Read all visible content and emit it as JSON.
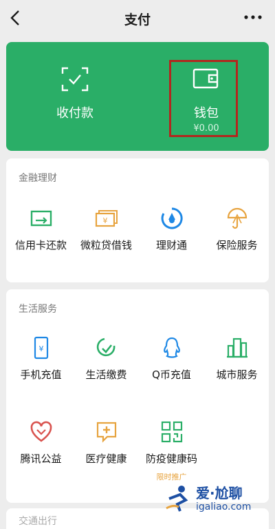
{
  "header": {
    "title": "支付"
  },
  "wallet_card": {
    "collect_pay_label": "收付款",
    "wallet_label": "钱包",
    "wallet_balance": "¥0.00"
  },
  "finance": {
    "title": "金融理财",
    "items": [
      {
        "label": "信用卡还款",
        "icon": "credit-card-icon"
      },
      {
        "label": "微粒贷借钱",
        "icon": "loan-icon"
      },
      {
        "label": "理财通",
        "icon": "wealth-icon"
      },
      {
        "label": "保险服务",
        "icon": "insurance-icon"
      }
    ]
  },
  "life": {
    "title": "生活服务",
    "items": [
      {
        "label": "手机充值",
        "icon": "phone-icon"
      },
      {
        "label": "生活缴费",
        "icon": "bill-icon"
      },
      {
        "label": "Q币充值",
        "icon": "qq-icon"
      },
      {
        "label": "城市服务",
        "icon": "city-icon"
      },
      {
        "label": "腾讯公益",
        "icon": "charity-icon"
      },
      {
        "label": "医疗健康",
        "icon": "medical-icon"
      },
      {
        "label": "防疫健康码",
        "icon": "qrcode-icon",
        "tag": "限时推广"
      }
    ]
  },
  "next_section": {
    "title": "交通出行"
  },
  "watermark": {
    "line1": "爱·尬聊",
    "line2": "igaliao.com"
  }
}
